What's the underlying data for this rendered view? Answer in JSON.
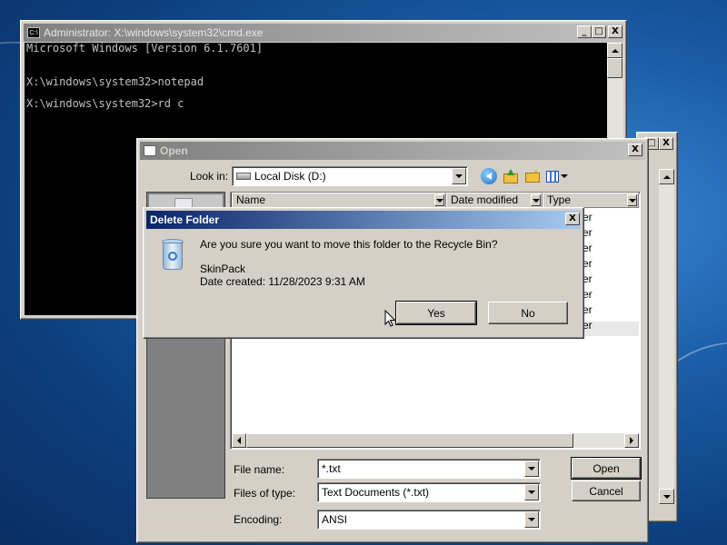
{
  "cmd_window": {
    "title": "Administrator: X:\\windows\\system32\\cmd.exe",
    "icon_text": "C:\\",
    "controls": [
      "_",
      "□",
      "X"
    ],
    "lines": [
      "Microsoft Windows [Version 6.1.7601]",
      "",
      "X:\\windows\\system32>notepad",
      "",
      "X:\\windows\\system32>rd c"
    ]
  },
  "open_dialog": {
    "title": "Open",
    "close": "X",
    "look_in_label": "Look in:",
    "look_in_value": "Local Disk (D:)",
    "columns": [
      "Name",
      "Date modified",
      "Type"
    ],
    "row_type_fragments": [
      "er",
      "er",
      "er",
      "er",
      "er",
      "er",
      "er",
      "er"
    ],
    "file_name_label": "File name:",
    "file_name_value": "*.txt",
    "files_of_type_label": "Files of type:",
    "files_of_type_value": "Text Documents (*.txt)",
    "encoding_label": "Encoding:",
    "encoding_value": "ANSI",
    "open_button": "Open",
    "cancel_button": "Cancel"
  },
  "behind_window": {
    "controls": [
      "□",
      "X"
    ]
  },
  "delete_dialog": {
    "title": "Delete Folder",
    "close": "X",
    "question": "Are you sure you want to move this folder to the Recycle Bin?",
    "item_name": "SkinPack",
    "item_date": "Date created: 11/28/2023 9:31 AM",
    "yes_button": "Yes",
    "no_button": "No"
  },
  "icons": {
    "recycle_bin": "recycle-bin-icon",
    "back": "back-arrow-icon",
    "up": "up-folder-icon",
    "new_folder": "new-folder-icon",
    "views": "views-menu-icon",
    "drive": "hard-drive-icon",
    "cursor": "mouse-pointer-icon"
  },
  "colors": {
    "titlebar_active": "#0a246a",
    "titlebar_inactive": "#808080",
    "face": "#d4d0c8",
    "console_bg": "#000000"
  }
}
